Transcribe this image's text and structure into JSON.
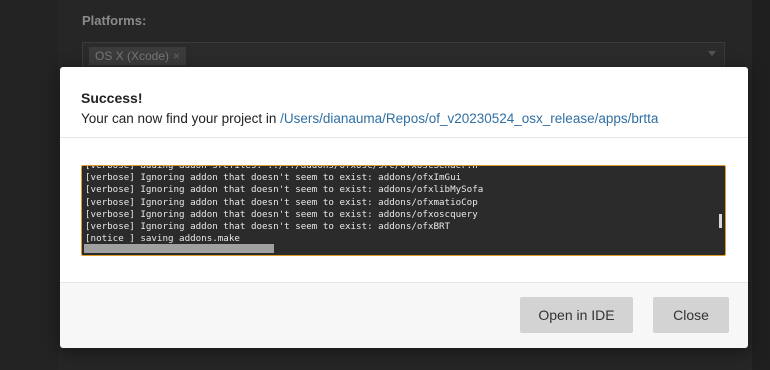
{
  "background": {
    "platforms_label": "Platforms:",
    "platform_chip": "OS X (Xcode)",
    "chip_remove": "×"
  },
  "modal": {
    "title": "Success!",
    "message_prefix": "Your can now find your project in ",
    "project_path": "/Users/dianauma/Repos/of_v20230524_osx_release/apps/brtta",
    "console_lines": [
      "[verbose] adding addon srcfiles: ../../addons/ofxOsc/src/ofxOscSender.h",
      "[verbose] Ignoring addon that doesn't seem to exist: addons/ofxImGui",
      "[verbose] Ignoring addon that doesn't seem to exist: addons/ofxlibMySofa",
      "[verbose] Ignoring addon that doesn't seem to exist: addons/ofxmatioCop",
      "[verbose] Ignoring addon that doesn't seem to exist: addons/ofxoscquery",
      "[verbose] Ignoring addon that doesn't seem to exist: addons/ofxBRT",
      "[notice ] saving addons.make"
    ],
    "buttons": {
      "open_ide": "Open in IDE",
      "close": "Close"
    }
  },
  "colors": {
    "link": "#2f6fa3",
    "console_border": "#e09a2a",
    "console_bg": "#2b2b2b"
  }
}
